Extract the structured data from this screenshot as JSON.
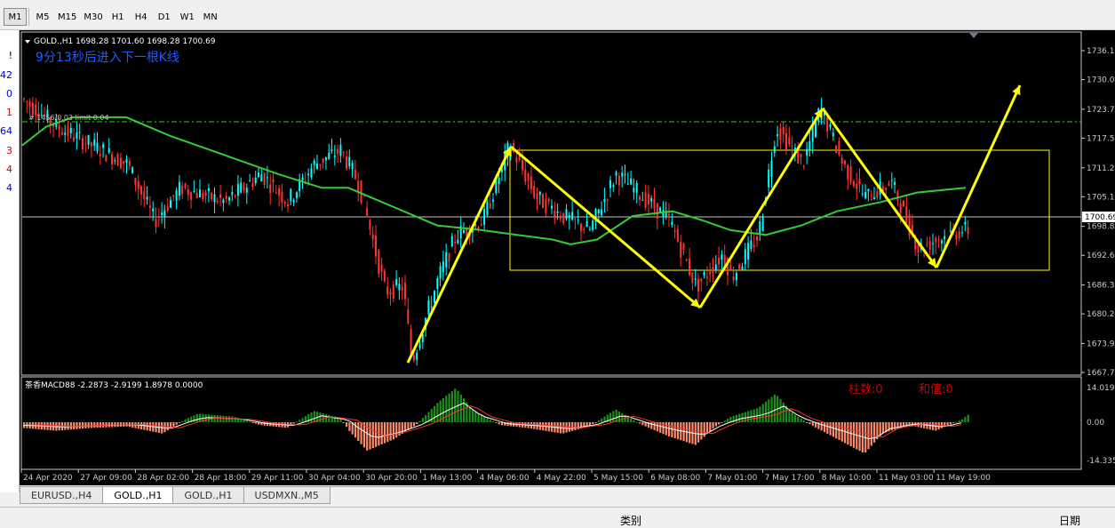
{
  "toolbar": {
    "timeframes": [
      {
        "label": "M1",
        "active": true
      },
      {
        "label": "M5",
        "active": false
      },
      {
        "label": "M15",
        "active": false
      },
      {
        "label": "M30",
        "active": false
      },
      {
        "label": "H1",
        "active": false
      },
      {
        "label": "H4",
        "active": false
      },
      {
        "label": "D1",
        "active": false
      },
      {
        "label": "W1",
        "active": false
      },
      {
        "label": "MN",
        "active": false
      }
    ]
  },
  "left_panel": [
    {
      "text": "!",
      "color": "#000000"
    },
    {
      "text": "42",
      "color": "#0000cc"
    },
    {
      "text": "0",
      "color": "#0000cc"
    },
    {
      "text": "1",
      "color": "#cc0000"
    },
    {
      "text": "64",
      "color": "#0000cc"
    },
    {
      "text": "3",
      "color": "#cc0000"
    },
    {
      "text": "4",
      "color": "#cc0000"
    },
    {
      "text": "4",
      "color": "#0000cc"
    }
  ],
  "chart": {
    "header": "GOLD.,H1  1698.28 1701.60 1698.28 1700.69",
    "countdown": "9分13秒后进入下一根K线",
    "level_label": "# 1456/0.03 limit 0.04",
    "current_price": "1700.69",
    "price_axis": [
      "1736.15",
      "1730.00",
      "1723.70",
      "1717.55",
      "1711.25",
      "1705.10",
      "1698.80",
      "1692.65",
      "1686.35",
      "1680.20",
      "1673.90",
      "1667.75"
    ],
    "time_axis": [
      "24 Apr 2020",
      "27 Apr 09:00",
      "28 Apr 02:00",
      "28 Apr 18:00",
      "29 Apr 11:00",
      "30 Apr 04:00",
      "30 Apr 20:00",
      "1 May 13:00",
      "4 May 06:00",
      "4 May 22:00",
      "5 May 15:00",
      "6 May 08:00",
      "7 May 01:00",
      "7 May 17:00",
      "8 May 10:00",
      "11 May 03:00",
      "11 May 19:00"
    ],
    "macd_header": "茶香MACD88 -2.2873 -2.9199 1.8978 0.0000",
    "macd_axis": [
      "14.0192",
      "0.00",
      "-14.3353"
    ],
    "macd_stat_1": "柱数:0",
    "macd_stat_2": "和值:0",
    "colors": {
      "bull": "#00ffff",
      "bear": "#ff3333",
      "ma": "#33cc33",
      "annot": "#ffff00",
      "hist_pos": "#1a8f1a",
      "hist_neg": "#ff8c69"
    }
  },
  "tabs": [
    {
      "label": "EURUSD.,H4",
      "active": false
    },
    {
      "label": "GOLD.,H1",
      "active": true
    },
    {
      "label": "GOLD.,H1",
      "active": false
    },
    {
      "label": "USDMXN.,M5",
      "active": false
    }
  ],
  "bottom": {
    "label_1": "类别",
    "label_2": "日期"
  }
}
